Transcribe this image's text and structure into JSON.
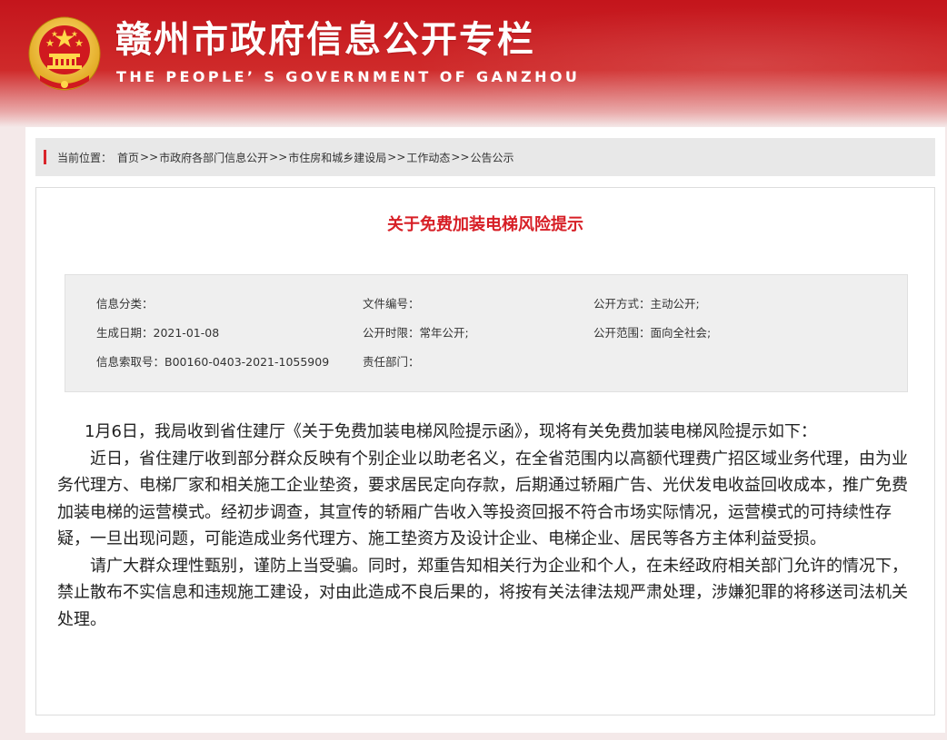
{
  "header": {
    "title": "赣州市政府信息公开专栏",
    "subtitle": "THE PEOPLE’ S GOVERNMENT OF GANZHOU"
  },
  "breadcrumb": {
    "label": "当前位置：",
    "items": [
      "首页",
      "市政府各部门信息公开",
      "市住房和城乡建设局",
      "工作动态",
      "公告公示"
    ],
    "separator": ">>"
  },
  "article": {
    "title": "关于免费加装电梯风险提示",
    "meta": {
      "category": "信息分类：",
      "doc_number": "文件编号：",
      "disclosure_mode": "公开方式：主动公开;",
      "date": "生成日期：2021-01-08",
      "disclosure_period": "公开时限：常年公开;",
      "disclosure_scope": "公开范围：面向全社会;",
      "index_number": "信息索取号：B00160-0403-2021-1055909",
      "department": "责任部门："
    },
    "paragraphs": [
      "1月6日，我局收到省住建厅《关于免费加装电梯风险提示函》，现将有关免费加装电梯风险提示如下：",
      "近日，省住建厅收到部分群众反映有个别企业以助老名义，在全省范围内以高额代理费广招区域业务代理，由为业务代理方、电梯厂家和相关施工企业垫资，要求居民定向存款，后期通过轿厢广告、光伏发电收益回收成本，推广免费加装电梯的运营模式。经初步调查，其宣传的轿厢广告收入等投资回报不符合市场实际情况，运营模式的可持续性存疑，一旦出现问题，可能造成业务代理方、施工垫资方及设计企业、电梯企业、居民等各方主体利益受损。",
      "请广大群众理性甄别，谨防上当受骗。同时，郑重告知相关行为企业和个人，在未经政府相关部门允许的情况下，禁止散布不实信息和违规施工建设，对由此造成不良后果的，将按有关法律法规严肃处理，涉嫌犯罪的将移送司法机关处理。"
    ]
  },
  "colors": {
    "header_red": "#c4151c",
    "title_red": "#d71f26",
    "breadcrumb_bg": "#e8e8e8",
    "meta_bg": "#efefef",
    "emblem_gold": "#f2c230"
  },
  "icons": {
    "emblem": "national-emblem-icon"
  }
}
